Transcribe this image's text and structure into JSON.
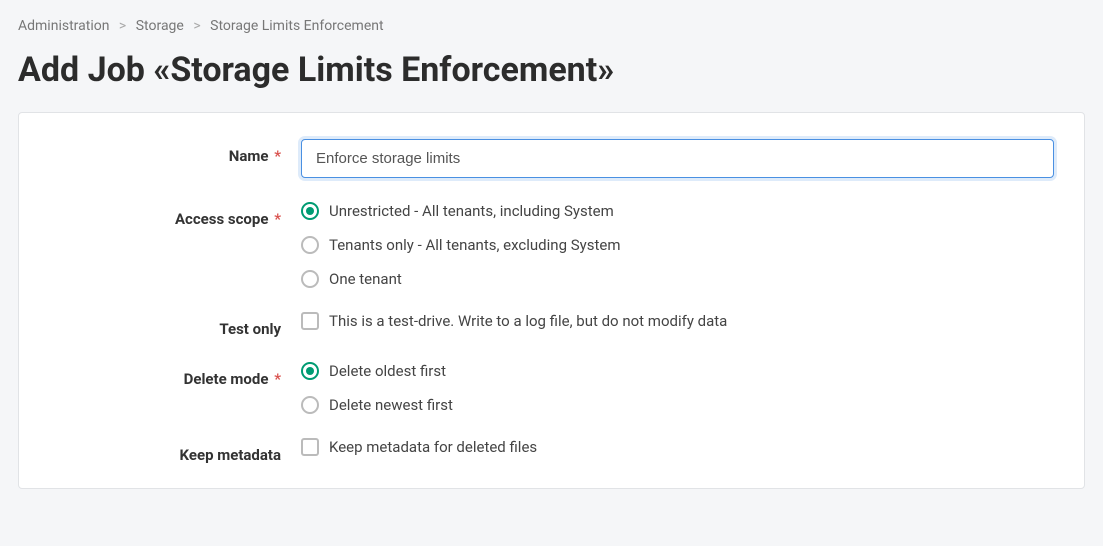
{
  "breadcrumb": {
    "items": [
      "Administration",
      "Storage",
      "Storage Limits Enforcement"
    ]
  },
  "page_title": "Add Job «Storage Limits Enforcement»",
  "form": {
    "name": {
      "label": "Name",
      "required": true,
      "value": "Enforce storage limits"
    },
    "access_scope": {
      "label": "Access scope",
      "required": true,
      "options": [
        {
          "label": "Unrestricted - All tenants, including System",
          "checked": true
        },
        {
          "label": "Tenants only - All tenants, excluding System",
          "checked": false
        },
        {
          "label": "One tenant",
          "checked": false
        }
      ]
    },
    "test_only": {
      "label": "Test only",
      "option_label": "This is a test-drive. Write to a log file, but do not modify data",
      "checked": false
    },
    "delete_mode": {
      "label": "Delete mode",
      "required": true,
      "options": [
        {
          "label": "Delete oldest first",
          "checked": true
        },
        {
          "label": "Delete newest first",
          "checked": false
        }
      ]
    },
    "keep_metadata": {
      "label": "Keep metadata",
      "option_label": "Keep metadata for deleted files",
      "checked": false
    }
  },
  "misc": {
    "required_marker": "*",
    "breadcrumb_separator": ">"
  }
}
